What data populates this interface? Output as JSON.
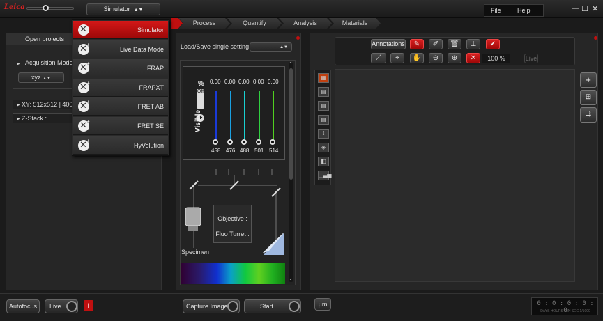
{
  "titlebar": {
    "logo": "Leica",
    "mode_selector": "Simulator",
    "menu_file": "File",
    "menu_help": "Help",
    "min": "—",
    "max": "☐",
    "close": "✕"
  },
  "tabs": [
    "Process",
    "Quantify",
    "Analysis",
    "Materials"
  ],
  "mode_menu": {
    "items": [
      {
        "label": "Simulator",
        "active": true
      },
      {
        "label": "Live Data Mode",
        "active": false
      },
      {
        "label": "FRAP",
        "active": false
      },
      {
        "label": "FRAPXT",
        "active": false
      },
      {
        "label": "FRET AB",
        "active": false
      },
      {
        "label": "FRET SE",
        "active": false
      },
      {
        "label": "HyVolution",
        "active": false
      }
    ]
  },
  "left_panel": {
    "header": "Open projects",
    "acquisition_mode_label": "Acquisition Mode",
    "acquisition_mode_value": "xyz",
    "xy_row": "XY: 512x512 | 400",
    "zstack_row": "Z-Stack :"
  },
  "mid_panel": {
    "load_save_label": "Load/Save single setting :",
    "load_save_value": "",
    "percent_label": "%",
    "onoff_label": "Off",
    "visible_label": "Visible",
    "laser_values": [
      "0.00",
      "0.00",
      "0.00",
      "0.00",
      "0.00"
    ],
    "wavelengths": [
      "458",
      "476",
      "488",
      "501",
      "514"
    ],
    "laser_colors": [
      "#1a3ad8",
      "#1aa0e0",
      "#1ad0d0",
      "#30d040",
      "#50d020"
    ],
    "objective_label": "Objective :",
    "fluo_turret_label": "Fluo Turret :",
    "specimen_label": "Specimen"
  },
  "viewer": {
    "annotations_label": "Annotations",
    "zoom_value": "100 %",
    "live_label": "Live"
  },
  "bottom": {
    "autofocus": "Autofocus",
    "live": "Live",
    "info": "i",
    "capture_image": "Capture Image",
    "start": "Start",
    "unit": "µm",
    "timer": "0 : 0 : 0 : 0 : 0",
    "timer_units": "DAYS HOURS MIN SEC 1/1000"
  },
  "colors": {
    "accent_red": "#c01010",
    "background": "#1b1b1b",
    "panel": "#262626"
  }
}
